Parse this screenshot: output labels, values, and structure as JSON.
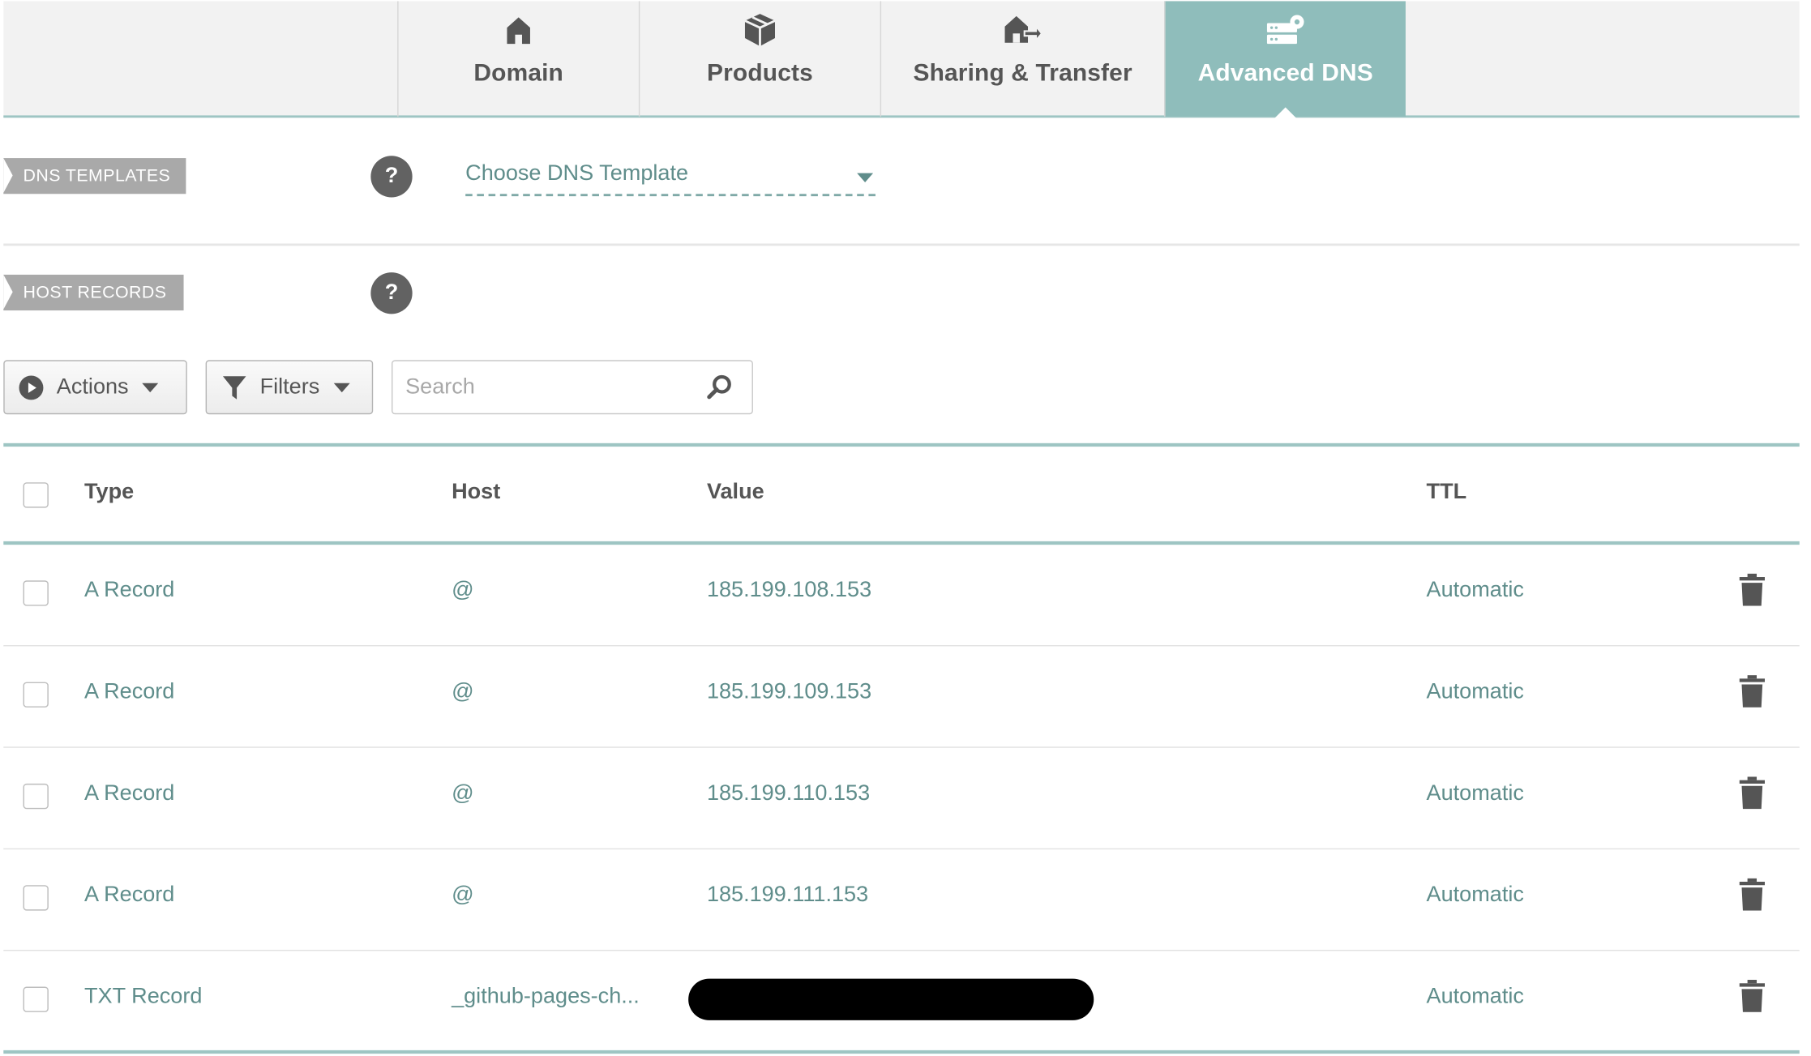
{
  "tabs": [
    {
      "label": "Domain",
      "icon": "home-icon",
      "active": false
    },
    {
      "label": "Products",
      "icon": "box-icon",
      "active": false
    },
    {
      "label": "Sharing & Transfer",
      "icon": "transfer-icon",
      "active": false
    },
    {
      "label": "Advanced DNS",
      "icon": "server-gear-icon",
      "active": true
    }
  ],
  "dns_templates": {
    "tag": "DNS TEMPLATES",
    "help": "?",
    "select_value": "Choose DNS Template"
  },
  "host_records": {
    "tag": "HOST RECORDS",
    "help": "?"
  },
  "toolbar": {
    "actions_label": "Actions",
    "filters_label": "Filters",
    "search_placeholder": "Search"
  },
  "table": {
    "headers": {
      "type": "Type",
      "host": "Host",
      "value": "Value",
      "ttl": "TTL"
    },
    "rows": [
      {
        "type": "A Record",
        "host": "@",
        "value": "185.199.108.153",
        "ttl": "Automatic"
      },
      {
        "type": "A Record",
        "host": "@",
        "value": "185.199.109.153",
        "ttl": "Automatic"
      },
      {
        "type": "A Record",
        "host": "@",
        "value": "185.199.110.153",
        "ttl": "Automatic"
      },
      {
        "type": "A Record",
        "host": "@",
        "value": "185.199.111.153",
        "ttl": "Automatic"
      },
      {
        "type": "TXT Record",
        "host": "_github-pages-ch...",
        "value": "",
        "ttl": "Automatic"
      }
    ]
  },
  "colors": {
    "accent": "#8fbdbb",
    "link_text": "#5f8d8b",
    "tag_bg": "#a9a9a9",
    "help_bg": "#626262"
  }
}
